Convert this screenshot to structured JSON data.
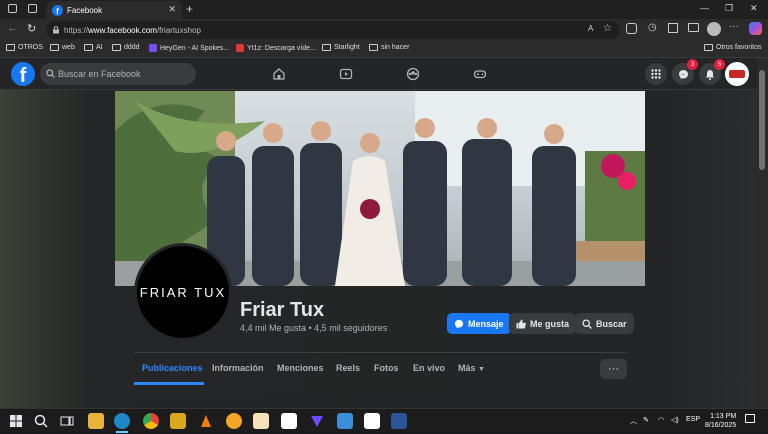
{
  "browser": {
    "tab_title": "Facebook",
    "url_prefix": "https://",
    "url_domain": "www.facebook.com",
    "url_path": "/friartuxshop",
    "bookmarks": [
      {
        "label": "OTROS",
        "type": "folder"
      },
      {
        "label": "web",
        "type": "folder"
      },
      {
        "label": "AI",
        "type": "folder"
      },
      {
        "label": "dddd",
        "type": "folder"
      },
      {
        "label": "HeyGen - AI Spokes...",
        "type": "site",
        "color": "#7b4dff"
      },
      {
        "label": "Yt1z: Descarga víde...",
        "type": "site",
        "color": "#e53935"
      },
      {
        "label": "Starlight",
        "type": "folder"
      },
      {
        "label": "sin hacer",
        "type": "folder"
      }
    ],
    "other_favorites": "Otros favoritos"
  },
  "facebook": {
    "search_placeholder": "Buscar en Facebook",
    "messenger_badge": "3",
    "notifications_badge": "5",
    "brand_color": "#1877f2"
  },
  "page": {
    "avatar_text": "FRIAR TUX",
    "name": "Friar Tux",
    "stats": "4,4 mil Me gusta • 4,5 mil seguidores",
    "buttons": {
      "message": "Mensaje",
      "like": "Me gusta",
      "search": "Buscar"
    },
    "tabs": [
      "Publicaciones",
      "Información",
      "Menciones",
      "Reels",
      "Fotos",
      "En vivo",
      "Más"
    ],
    "active_tab": "Publicaciones",
    "more_dots": "···"
  },
  "taskbar": {
    "language": "ESP",
    "time": "1:13 PM",
    "date": "8/16/2025"
  }
}
